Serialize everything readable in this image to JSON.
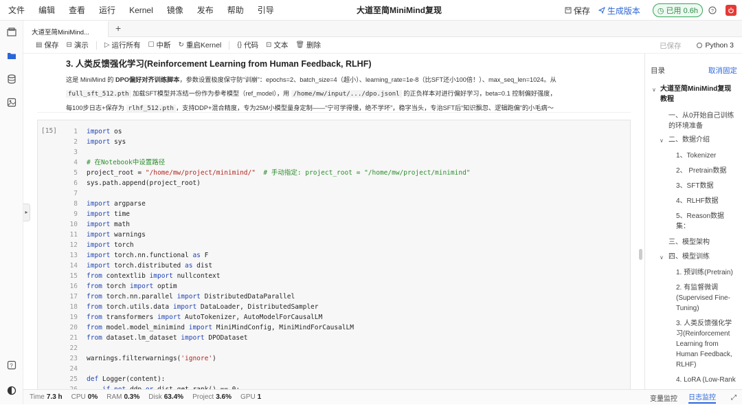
{
  "menu": [
    "文件",
    "编辑",
    "查看",
    "运行",
    "Kernel",
    "镜像",
    "发布",
    "帮助",
    "引导"
  ],
  "doc_title": "大道至简MiniMind复现",
  "top_right": {
    "save_label": "保存",
    "publish_label": "生成版本",
    "usage_label": "已用 0.6h"
  },
  "tab": {
    "label": "大道至简MiniMind...",
    "add": "+"
  },
  "toolbar": {
    "save": "保存",
    "present": "演示",
    "run_all": "运行所有",
    "interrupt": "中断",
    "restart": "重启Kernel",
    "code": "代码",
    "text": "文本",
    "delete": "删除",
    "saved_status": "已保存",
    "kernel": "Python 3"
  },
  "md_cell": {
    "title": "3. 人类反馈强化学习(Reinforcement Learning from Human Feedback, RLHF)",
    "p1_a": "这是 MiniMind 的 ",
    "p1_b": "DPO偏好对齐训练脚本",
    "p1_c": "，参数设置极度保守防“训崩”：epochs=2、batch_size=4（超小）、learning_rate=1e-8（比SFT还小100倍！）、max_seq_len=1024。从",
    "p2_code1": "full_sft_512.pth",
    "p2_a": " 加载SFT模型并冻结一份作为参考模型（ref_model），用 ",
    "p2_code2": "/home/mw/input/.../dpo.jsonl",
    "p2_b": " 的正负样本对进行偏好学习，beta=0.1 控制偏好强度，",
    "p3_a": "每100步日志+保存为 ",
    "p3_code": "rlhf_512.pth",
    "p3_b": "，支持DDP+混合精度，专为25M小模型量身定制——“宁可学得慢，绝不学坏”，稳字当头，专治SFT后“知识飘忽、逻辑跑偏”的小毛病～"
  },
  "code_cell": {
    "exec_count": "[15]",
    "lines": [
      [
        [
          "kw",
          "import"
        ],
        [
          "",
          "os"
        ]
      ],
      [
        [
          "kw",
          "import"
        ],
        [
          "",
          "sys"
        ]
      ],
      [],
      [
        [
          "cm",
          "# 在Notebook中设置路径"
        ]
      ],
      [
        [
          "",
          "project_root = "
        ],
        [
          "st",
          "\"/home/mw/project/minimind/\""
        ],
        [
          "",
          "  "
        ],
        [
          "cm",
          "# 手动指定: project_root = \"/home/mw/project/minimind\""
        ]
      ],
      [
        [
          "",
          "sys.path.append(project_root)"
        ]
      ],
      [],
      [
        [
          "kw",
          "import"
        ],
        [
          "",
          "argparse"
        ]
      ],
      [
        [
          "kw",
          "import"
        ],
        [
          "",
          "time"
        ]
      ],
      [
        [
          "kw",
          "import"
        ],
        [
          "",
          "math"
        ]
      ],
      [
        [
          "kw",
          "import"
        ],
        [
          "",
          "warnings"
        ]
      ],
      [
        [
          "kw",
          "import"
        ],
        [
          "",
          "torch"
        ]
      ],
      [
        [
          "kw",
          "import"
        ],
        [
          "",
          "torch.nn.functional "
        ],
        [
          "kw",
          "as"
        ],
        [
          "",
          "F"
        ]
      ],
      [
        [
          "kw",
          "import"
        ],
        [
          "",
          "torch.distributed "
        ],
        [
          "kw",
          "as"
        ],
        [
          "",
          "dist"
        ]
      ],
      [
        [
          "kw",
          "from"
        ],
        [
          "",
          "contextlib "
        ],
        [
          "kw",
          "import"
        ],
        [
          "",
          "nullcontext"
        ]
      ],
      [
        [
          "kw",
          "from"
        ],
        [
          "",
          "torch "
        ],
        [
          "kw",
          "import"
        ],
        [
          "",
          "optim"
        ]
      ],
      [
        [
          "kw",
          "from"
        ],
        [
          "",
          "torch.nn.parallel "
        ],
        [
          "kw",
          "import"
        ],
        [
          "",
          "DistributedDataParallel"
        ]
      ],
      [
        [
          "kw",
          "from"
        ],
        [
          "",
          "torch.utils.data "
        ],
        [
          "kw",
          "import"
        ],
        [
          "",
          "DataLoader, DistributedSampler"
        ]
      ],
      [
        [
          "kw",
          "from"
        ],
        [
          "",
          "transformers "
        ],
        [
          "kw",
          "import"
        ],
        [
          "",
          "AutoTokenizer, AutoModelForCausalLM"
        ]
      ],
      [
        [
          "kw",
          "from"
        ],
        [
          "",
          "model.model_minimind "
        ],
        [
          "kw",
          "import"
        ],
        [
          "",
          "MiniMindConfig, MiniMindForCausalLM"
        ]
      ],
      [
        [
          "kw",
          "from"
        ],
        [
          "",
          "dataset.lm_dataset "
        ],
        [
          "kw",
          "import"
        ],
        [
          "",
          "DPODataset"
        ]
      ],
      [],
      [
        [
          "",
          "warnings.filterwarnings("
        ],
        [
          "st",
          "'ignore'"
        ],
        [
          "",
          ")"
        ]
      ],
      [],
      [
        [
          "kw",
          "def"
        ],
        [
          "",
          "Logger(content):"
        ]
      ],
      [
        [
          "",
          "    "
        ],
        [
          "kw",
          "if not"
        ],
        [
          "",
          "ddp "
        ],
        [
          "kw",
          "or"
        ],
        [
          "",
          "dist.get_rank() == 0:"
        ]
      ]
    ]
  },
  "toc": {
    "title": "目录",
    "unpin": "取消固定",
    "items": [
      "大道至简MiniMind复现教程",
      "一、从0开始自己训练的环境准备",
      "二、数据介绍",
      "1、Tokenizer",
      "2、 Pretrain数据",
      "3、SFT数据",
      "4、RLHF数据",
      "5、Reason数据集：",
      "三、模型架构",
      "四、模型训练",
      "1. 预训练(Pretrain)",
      "2. 有监督微调(Supervised Fine-Tuning)",
      "3. 人类反馈强化学习(Reinforcement Learning from Human Feedback, RLHF)",
      "4. LoRA (Low-Rank"
    ]
  },
  "status": {
    "time_label": "Time",
    "time_value": "7.3 h",
    "cpu_label": "CPU",
    "cpu_value": "0%",
    "ram_label": "RAM",
    "ram_value": "0.3%",
    "disk_label": "Disk",
    "disk_value": "63.4%",
    "project_label": "Project",
    "project_value": "3.6%",
    "gpu_label": "GPU",
    "gpu_value": "1",
    "tab_vars": "变量监控",
    "tab_logs": "日志监控"
  }
}
